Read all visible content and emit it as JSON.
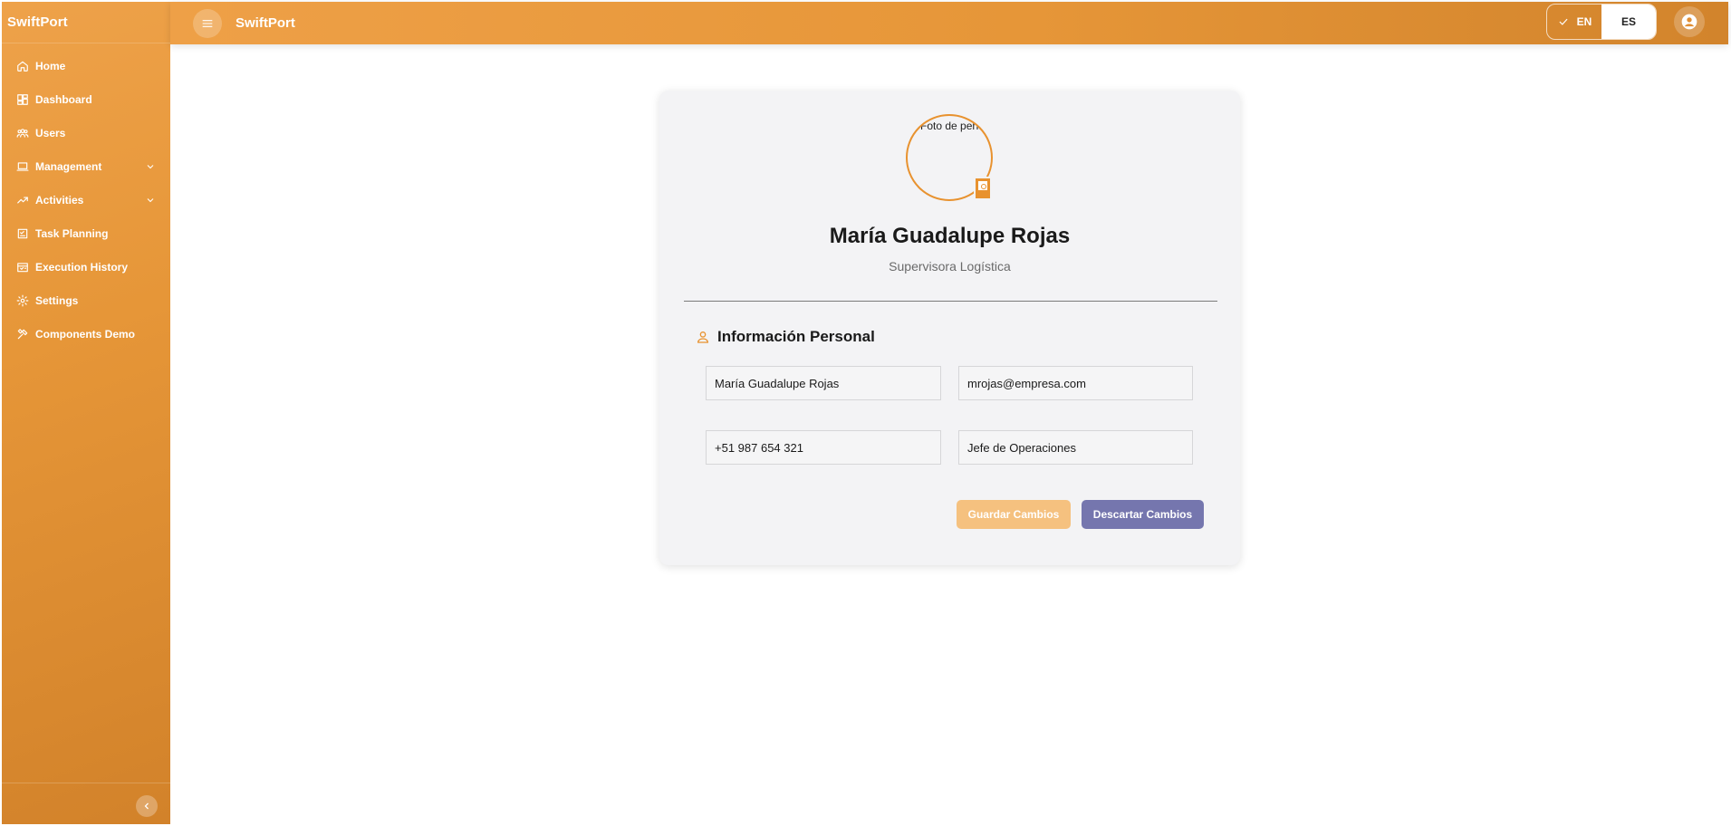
{
  "app": {
    "brand": "SwiftPort",
    "title": "SwiftPort"
  },
  "sidebar": {
    "items": [
      {
        "label": "Home",
        "icon": "home-icon"
      },
      {
        "label": "Dashboard",
        "icon": "dashboard-icon"
      },
      {
        "label": "Users",
        "icon": "users-icon"
      },
      {
        "label": "Management",
        "icon": "laptop-icon",
        "expandable": true
      },
      {
        "label": "Activities",
        "icon": "trending-icon",
        "expandable": true
      },
      {
        "label": "Task Planning",
        "icon": "task-icon"
      },
      {
        "label": "Execution History",
        "icon": "history-icon"
      },
      {
        "label": "Settings",
        "icon": "gear-icon"
      },
      {
        "label": "Components Demo",
        "icon": "tools-icon"
      }
    ]
  },
  "header": {
    "languages": {
      "active": "EN",
      "inactive": "ES"
    }
  },
  "profile": {
    "photo_alt": "Foto de perfil",
    "name": "María Guadalupe Rojas",
    "role": "Supervisora Logística",
    "section_title": "Información Personal",
    "fields": {
      "full_name": "María Guadalupe Rojas",
      "email": "mrojas@empresa.com",
      "phone": "+51 987 654 321",
      "position": "Jefe de Operaciones"
    },
    "buttons": {
      "save": "Guardar Cambios",
      "discard": "Descartar Cambios"
    }
  },
  "colors": {
    "primary": "#e8922f",
    "save_button": "#f5c17f",
    "discard_button": "#7576ae",
    "card_background": "#f3f3f5"
  }
}
